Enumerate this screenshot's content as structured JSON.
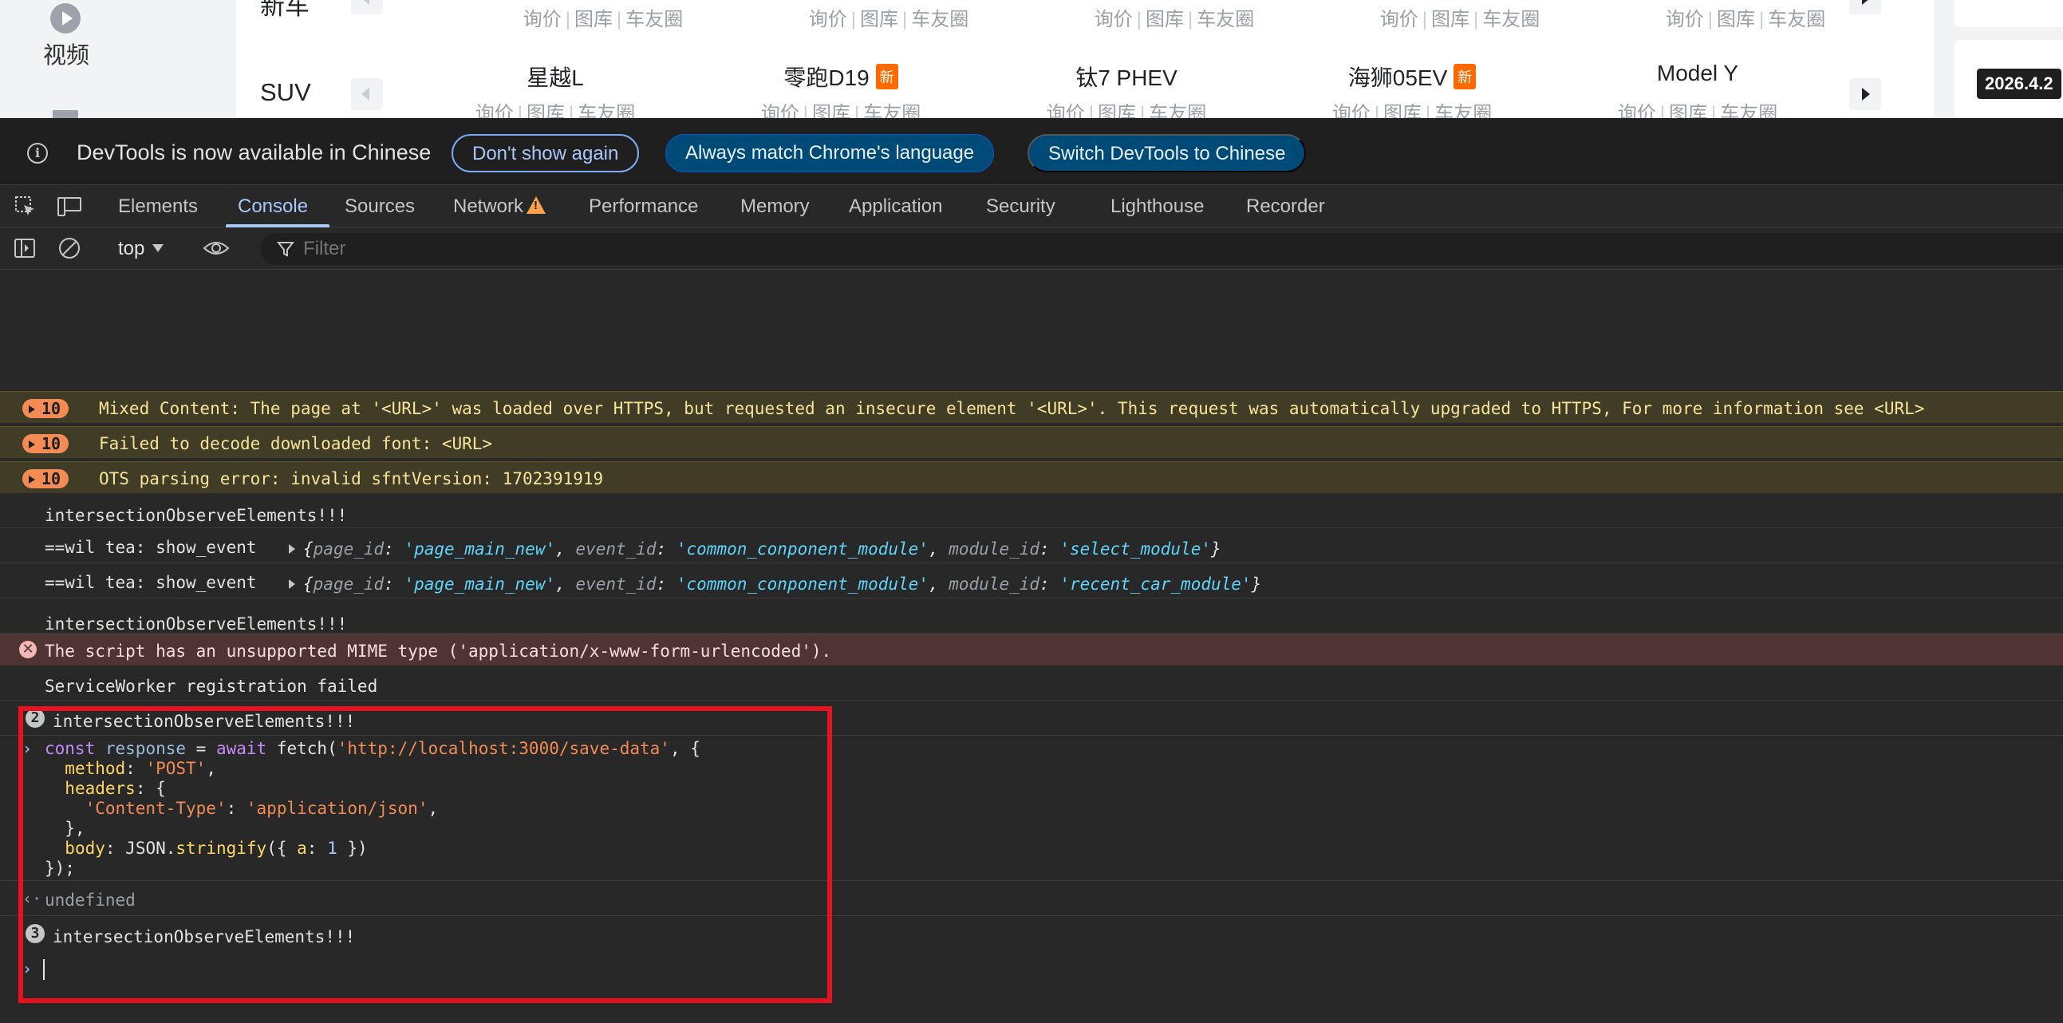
{
  "webpage": {
    "nav": {
      "video_label": "视频"
    },
    "partial_row_label": "新车",
    "rows": [
      {
        "label": "SUV",
        "cars": [
          {
            "name": "星越L",
            "badge": ""
          },
          {
            "name": "零跑D19",
            "badge": "新"
          },
          {
            "name": "钛7 PHEV",
            "badge": ""
          },
          {
            "name": "海狮05EV",
            "badge": "新"
          },
          {
            "name": "Model Y",
            "badge": ""
          }
        ]
      }
    ],
    "car_links": {
      "inquiry": "询价",
      "gallery": "图库",
      "club": "车友圈",
      "sep": "|"
    },
    "date_tag": "2026.4.2"
  },
  "devtools": {
    "infobar": {
      "message": "DevTools is now available in Chinese",
      "dont_show": "Don't show again",
      "always_match": "Always match Chrome's language",
      "switch": "Switch DevTools to Chinese"
    },
    "tabs": [
      "Elements",
      "Console",
      "Sources",
      "Network",
      "Performance",
      "Memory",
      "Application",
      "Security",
      "Lighthouse",
      "Recorder"
    ],
    "active_tab": "Console",
    "toolbar": {
      "context": "top",
      "filter_placeholder": "Filter"
    },
    "messages": {
      "warn1": {
        "count": "10",
        "text": "Mixed Content: The page at '<URL>' was loaded over HTTPS, but requested an insecure element '<URL>'. This request was automatically upgraded to HTTPS, For more information see <URL>"
      },
      "warn2": {
        "count": "10",
        "text": "Failed to decode downloaded font: <URL>"
      },
      "warn3": {
        "count": "10",
        "text": "OTS parsing error: invalid sfntVersion: 1702391919"
      },
      "log1": "intersectionObserveElements!!!",
      "event1": {
        "prefix": "==wil tea: show_event",
        "page_id_val": "'page_main_new'",
        "event_id_val": "'common_conponent_module'",
        "module_id_val": "'select_module'"
      },
      "event2": {
        "prefix": "==wil tea: show_event",
        "page_id_val": "'page_main_new'",
        "event_id_val": "'common_conponent_module'",
        "module_id_val": "'recent_car_module'"
      },
      "keys": {
        "page_id": "page_id",
        "event_id": "event_id",
        "module_id": "module_id"
      },
      "log2": "intersectionObserveElements!!!",
      "error": "The script has an unsupported MIME type ('application/x-www-form-urlencoded').",
      "sw": "ServiceWorker registration failed",
      "group1": {
        "count": "2",
        "text": "intersectionObserveElements!!!"
      },
      "result": "undefined",
      "group2": {
        "count": "3",
        "text": "intersectionObserveElements!!!"
      }
    },
    "code": {
      "const": "const",
      "var": "response",
      "await": "await",
      "fetch": "fetch",
      "url": "'http://localhost:3000/save-data'",
      "method_key": "method",
      "method_val": "'POST'",
      "headers_key": "headers",
      "ct_key": "'Content-Type'",
      "ct_val": "'application/json'",
      "body_key": "body",
      "json": "JSON",
      "stringify": "stringify",
      "a_key": "a",
      "a_val": "1"
    }
  }
}
